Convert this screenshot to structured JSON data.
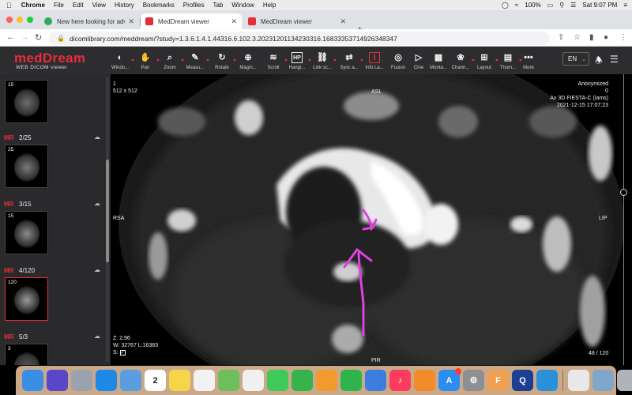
{
  "menubar": {
    "app": "Chrome",
    "items": [
      "File",
      "Edit",
      "View",
      "History",
      "Bookmarks",
      "Profiles",
      "Tab",
      "Window",
      "Help"
    ],
    "battery": "100%",
    "datetime": "Sat 9:07 PM"
  },
  "tabs": [
    {
      "title": "New here looking for advice a",
      "active": false
    },
    {
      "title": "MedDream viewer",
      "active": true
    },
    {
      "title": "MedDream viewer",
      "active": false
    }
  ],
  "address": {
    "url": "dicomlibrary.com/meddream/?study=1.3.6.1.4.1.44316.6.102.3.20231201134230316.16833353714926348347"
  },
  "app": {
    "logo": "medDream",
    "logo_sub": "WEB DICOM viewer",
    "tools": [
      {
        "label": "Windo...",
        "icon": "contrast-icon",
        "glyph": "◐",
        "caret": true
      },
      {
        "label": "Pan",
        "icon": "hand-icon",
        "glyph": "✋",
        "caret": true
      },
      {
        "label": "Zoom",
        "icon": "zoom-icon",
        "glyph": "⌕",
        "caret": true
      },
      {
        "label": "Measu...",
        "icon": "ruler-icon",
        "glyph": "✎",
        "caret": true
      },
      {
        "label": "Rotate",
        "icon": "rotate-icon",
        "glyph": "↻",
        "caret": true
      },
      {
        "label": "Magni...",
        "icon": "magnify-icon",
        "glyph": "⊕",
        "caret": false
      },
      {
        "label": "Scroll",
        "icon": "layers-icon",
        "glyph": "≋",
        "caret": true
      },
      {
        "label": "Hangi...",
        "icon": "hanging-protocol-icon",
        "glyph": "HP",
        "caret": true
      },
      {
        "label": "Link sc...",
        "icon": "link-icon",
        "glyph": "⛓",
        "caret": true
      },
      {
        "label": "Sync a...",
        "icon": "sync-icon",
        "glyph": "⇄",
        "caret": true
      },
      {
        "label": "Info La...",
        "icon": "info-icon",
        "glyph": "i",
        "caret": false
      },
      {
        "label": "Fusion",
        "icon": "fusion-icon",
        "glyph": "◎",
        "caret": false
      },
      {
        "label": "Cine",
        "icon": "play-icon",
        "glyph": "▷",
        "caret": false
      },
      {
        "label": "Monta...",
        "icon": "montage-icon",
        "glyph": "▦",
        "caret": false
      },
      {
        "label": "Chann...",
        "icon": "channels-icon",
        "glyph": "❀",
        "caret": true
      },
      {
        "label": "Layout",
        "icon": "layout-icon",
        "glyph": "⊞",
        "caret": true
      },
      {
        "label": "Thum...",
        "icon": "thumbnails-icon",
        "glyph": "▤",
        "caret": true
      },
      {
        "label": "More",
        "icon": "more-icon",
        "glyph": "•••",
        "caret": false
      }
    ],
    "language": "EN"
  },
  "series": [
    {
      "modality": "",
      "count": "",
      "thumb_count": "15",
      "selected": false
    },
    {
      "modality": "MR",
      "count": "2/25",
      "thumb_count": "25",
      "selected": false
    },
    {
      "modality": "MR",
      "count": "3/15",
      "thumb_count": "15",
      "selected": false
    },
    {
      "modality": "MR",
      "count": "4/120",
      "thumb_count": "120",
      "selected": true
    },
    {
      "modality": "MR",
      "count": "5/3",
      "thumb_count": "3",
      "selected": false
    }
  ],
  "viewport": {
    "top_left": [
      "1",
      "512 x 512"
    ],
    "top_right": [
      "Anonymized",
      "0",
      "Ax 3D FIESTA-C (iams)",
      "2021-12-15 17:07:23"
    ],
    "orient_top": "ASL",
    "orient_bottom": "PIR",
    "orient_left": "RSA",
    "orient_right": "LIP",
    "bottom_left": [
      "Z: 2.96",
      "W: 32767 L:16383",
      "S:"
    ],
    "bottom_right": "48 / 120",
    "annotation_color": "#e040e0"
  },
  "dock": {
    "apps": [
      {
        "name": "finder-icon",
        "color": "#3b8ee6",
        "glyph": ""
      },
      {
        "name": "siri-icon",
        "color": "#5a46c8",
        "glyph": ""
      },
      {
        "name": "launchpad-icon",
        "color": "#9aa3ad",
        "glyph": ""
      },
      {
        "name": "safari-icon",
        "color": "#1e88e5",
        "glyph": ""
      },
      {
        "name": "mail-icon",
        "color": "#5b9de0",
        "glyph": ""
      },
      {
        "name": "calendar-icon",
        "color": "#ffffff",
        "glyph": "2"
      },
      {
        "name": "notes-icon",
        "color": "#f7d54a",
        "glyph": ""
      },
      {
        "name": "reminders-icon",
        "color": "#f2f2f2",
        "glyph": ""
      },
      {
        "name": "maps-icon",
        "color": "#6cbf5b",
        "glyph": ""
      },
      {
        "name": "photos-icon",
        "color": "#f0f0f0",
        "glyph": ""
      },
      {
        "name": "messages-icon",
        "color": "#3fc95a",
        "glyph": ""
      },
      {
        "name": "facetime-icon",
        "color": "#37b24d",
        "glyph": ""
      },
      {
        "name": "pages-icon",
        "color": "#f29a2e",
        "glyph": ""
      },
      {
        "name": "numbers-icon",
        "color": "#2fb34b",
        "glyph": ""
      },
      {
        "name": "keynote-icon",
        "color": "#3d7de0",
        "glyph": ""
      },
      {
        "name": "music-icon",
        "color": "#fc3c5c",
        "glyph": "♪"
      },
      {
        "name": "books-icon",
        "color": "#f28c28",
        "glyph": ""
      },
      {
        "name": "app-store-icon",
        "color": "#2d8cf0",
        "glyph": "A"
      },
      {
        "name": "system-preferences-icon",
        "color": "#8e8e93",
        "glyph": "⚙"
      },
      {
        "name": "fontbook-icon",
        "color": "#f0a050",
        "glyph": "F"
      },
      {
        "name": "quicktime-icon",
        "color": "#1c3f94",
        "glyph": "Q"
      },
      {
        "name": "network-utility-icon",
        "color": "#2a90d8",
        "glyph": ""
      },
      {
        "name": "chrome-icon",
        "color": "#e8e8e8",
        "glyph": ""
      },
      {
        "name": "preview-icon",
        "color": "#7fa7c9",
        "glyph": ""
      },
      {
        "name": "trash-icon",
        "color": "#b0b3b8",
        "glyph": ""
      }
    ]
  }
}
